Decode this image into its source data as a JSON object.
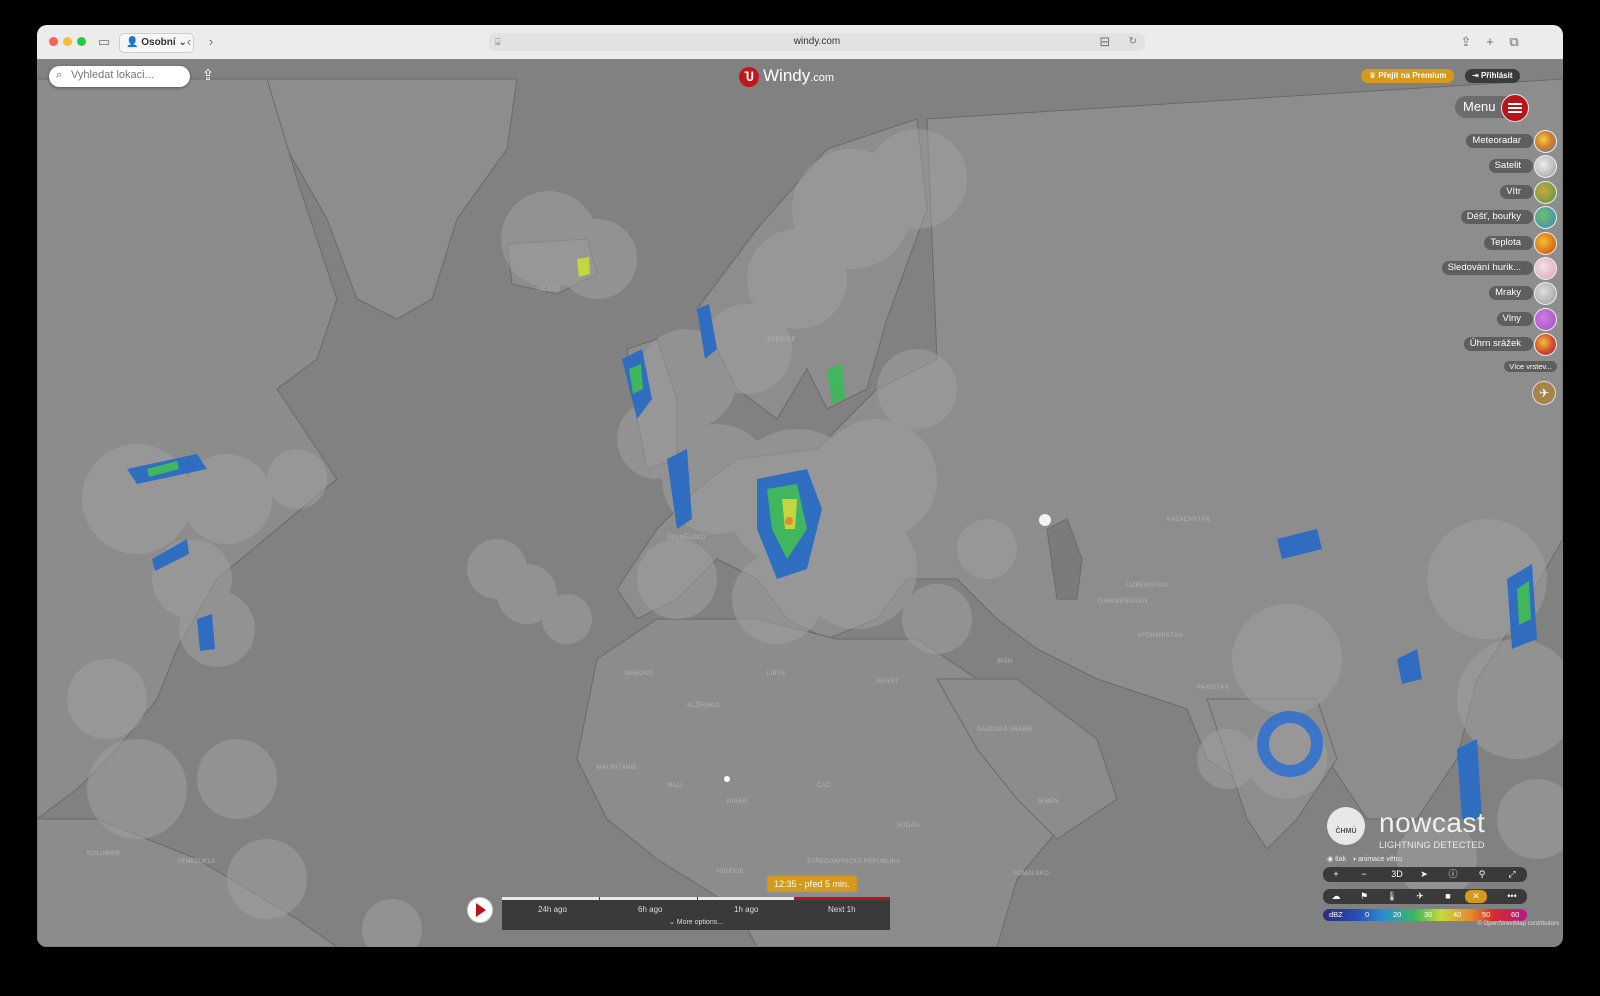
{
  "browser": {
    "profile_label": "Osobní",
    "url": "windy.com"
  },
  "map": {
    "search_placeholder": "Vyhledat lokaci...",
    "logo_main": "Windy",
    "logo_suffix": ".com",
    "premium_label": "Přejít na Premium",
    "login_label": "Přihlásit",
    "menu_label": "Menu",
    "layers": [
      {
        "label": "Meteoradar",
        "color": "#d77c2a"
      },
      {
        "label": "Satelit",
        "color": "#9a9a9a"
      },
      {
        "label": "Vítr",
        "color": "#8fa13e"
      },
      {
        "label": "Déšť, bouřky",
        "color": "#3f86c4"
      },
      {
        "label": "Teplota",
        "color": "#e07b19"
      },
      {
        "label": "Sledování hurik...",
        "color": "#d9a3b3"
      },
      {
        "label": "Mraky",
        "color": "#b5b5b5"
      },
      {
        "label": "Vlny",
        "color": "#9b4fc9"
      },
      {
        "label": "Úhrn srážek",
        "color": "#d6492b"
      }
    ],
    "more_layers": "Více vrstev...",
    "place_labels": [
      "Island",
      "Sverige",
      "Kazachstan",
      "Turkmenistan",
      "Uzbekistan",
      "Afghánistán",
      "Pákistán",
      "Írán",
      "Saúdská Arábie",
      "Egypt",
      "Libye",
      "Alžírsko",
      "Mali",
      "Niger",
      "Čad",
      "Súdán",
      "Jemen",
      "Somálsko",
      "Mauritánie",
      "Maroko",
      "Venezuela",
      "Kolumbie",
      "Středoafrická republika",
      "Španělsko",
      "Nigérie"
    ]
  },
  "timeline": {
    "current_time": "12:35 - před 5 min.",
    "labels": [
      "24h ago",
      "6h ago",
      "1h ago",
      "Next 1h"
    ],
    "more_options": "More options..."
  },
  "nowcast": {
    "org": "ČHMÚ",
    "title": "nowcast",
    "subtitle": "LIGHTNING DETECTED"
  },
  "toggles": {
    "pressure": "tlak",
    "animation": "animace větru"
  },
  "controls": {
    "zoom_in": "+",
    "zoom_out": "−",
    "three_d": "3D"
  },
  "legend": {
    "unit": "dBZ",
    "ticks": [
      "0",
      "20",
      "30",
      "40",
      "50",
      "60"
    ]
  },
  "credits": "© OpenStreetMap contributors",
  "colors": {
    "accent_red": "#b9141b",
    "premium_gold": "#d39a1b",
    "map_sea": "#818181",
    "map_land": "#8c8c8c"
  }
}
